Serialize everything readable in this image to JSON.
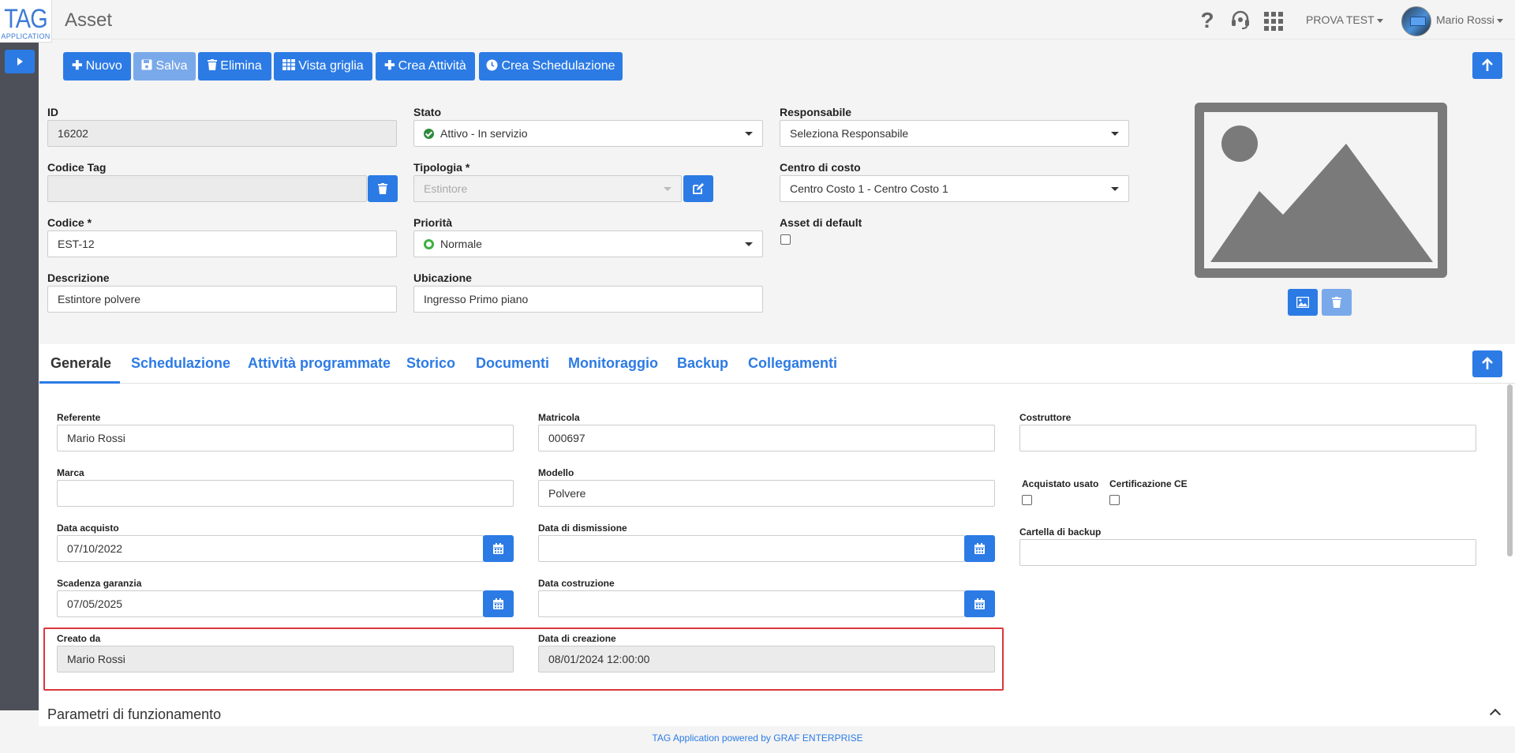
{
  "header": {
    "logo_big": "TAG",
    "logo_small": "APPLICATION",
    "title": "Asset",
    "help_glyph": "?",
    "icons": [
      "question-icon",
      "headset-icon",
      "apps-grid-icon"
    ],
    "company": "PROVA TEST",
    "user": "Mario Rossi"
  },
  "toolbar": {
    "nuovo": "Nuovo",
    "salva": "Salva",
    "elimina": "Elimina",
    "vista_griglia": "Vista griglia",
    "crea_attivita": "Crea Attività",
    "crea_schedulazione": "Crea Schedulazione"
  },
  "form": {
    "id": {
      "label": "ID",
      "value": "16202"
    },
    "codice_tag": {
      "label": "Codice Tag",
      "value": ""
    },
    "codice": {
      "label": "Codice *",
      "value": "EST-12"
    },
    "descrizione": {
      "label": "Descrizione",
      "value": "Estintore polvere"
    },
    "stato": {
      "label": "Stato",
      "value": "Attivo - In servizio",
      "color": "#2e8b3c"
    },
    "tipologia": {
      "label": "Tipologia *",
      "value": "Estintore"
    },
    "priorita": {
      "label": "Priorità",
      "value": "Normale",
      "color": "#3cb043"
    },
    "ubicazione": {
      "label": "Ubicazione",
      "value": "Ingresso Primo piano"
    },
    "responsabile": {
      "label": "Responsabile",
      "value": "Seleziona Responsabile"
    },
    "centro_costo": {
      "label": "Centro di costo",
      "value": "Centro Costo 1 - Centro Costo 1"
    },
    "asset_default": {
      "label": "Asset di default",
      "checked": false
    }
  },
  "tabs": [
    {
      "label": "Generale",
      "active": true
    },
    {
      "label": "Schedulazione"
    },
    {
      "label": "Attività programmate"
    },
    {
      "label": "Storico"
    },
    {
      "label": "Documenti"
    },
    {
      "label": "Monitoraggio"
    },
    {
      "label": "Backup"
    },
    {
      "label": "Collegamenti"
    }
  ],
  "generale": {
    "referente": {
      "label": "Referente",
      "value": "Mario Rossi"
    },
    "marca": {
      "label": "Marca",
      "value": ""
    },
    "data_acquisto": {
      "label": "Data acquisto",
      "value": "07/10/2022"
    },
    "scadenza_garanzia": {
      "label": "Scadenza garanzia",
      "value": "07/05/2025"
    },
    "creato_da": {
      "label": "Creato da",
      "value": "Mario Rossi"
    },
    "matricola": {
      "label": "Matricola",
      "value": "000697"
    },
    "modello": {
      "label": "Modello",
      "value": "Polvere"
    },
    "data_dismissione": {
      "label": "Data di dismissione",
      "value": ""
    },
    "data_costruzione": {
      "label": "Data costruzione",
      "value": ""
    },
    "data_creazione": {
      "label": "Data di creazione",
      "value": "08/01/2024 12:00:00"
    },
    "costruttore": {
      "label": "Costruttore",
      "value": ""
    },
    "acquistato_usato": {
      "label": "Acquistato usato",
      "checked": false
    },
    "certificazione_ce": {
      "label": "Certificazione CE",
      "checked": false
    },
    "cartella_backup": {
      "label": "Cartella di backup",
      "value": ""
    }
  },
  "section": {
    "parametri": "Parametri di funzionamento"
  },
  "footer": {
    "text": "TAG Application powered by GRAF ENTERPRISE"
  },
  "colors": {
    "primary": "#2c7be5",
    "highlight": "#d9373c"
  }
}
